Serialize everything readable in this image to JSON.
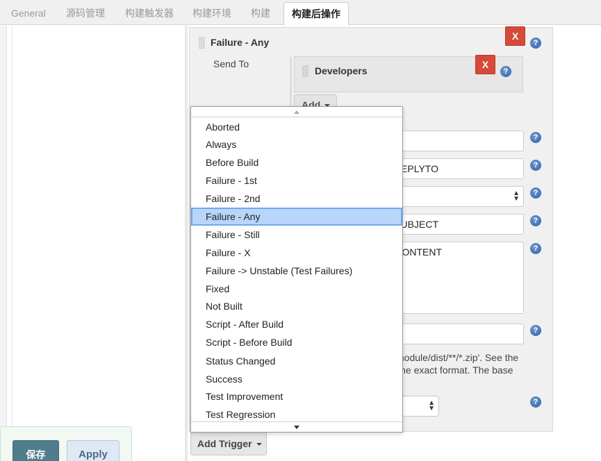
{
  "tabs": [
    {
      "label": "General"
    },
    {
      "label": "源码管理"
    },
    {
      "label": "构建触发器"
    },
    {
      "label": "构建环境"
    },
    {
      "label": "构建"
    },
    {
      "label": "构建后操作"
    }
  ],
  "trigger": {
    "title": "Failure - Any",
    "send_to_label": "Send To",
    "remove_label": "X",
    "help_label": "?"
  },
  "recipient": {
    "title": "Developers",
    "remove_label": "X",
    "add_label": "Add"
  },
  "fields": {
    "recipient_list": "",
    "reply_to": "$DEFAULT_REPLYTO",
    "content_type": "",
    "subject": "$DEFAULT_SUBJECT",
    "content": "$DEFAULT_CONTENT",
    "attachments": "",
    "attachments_help": [
      "module/dist/**/*.zip'. See the",
      "for the exact format. The base"
    ]
  },
  "dropdown": {
    "selected": "Failure - Any",
    "options": [
      "Aborted",
      "Always",
      "Before Build",
      "Failure - 1st",
      "Failure - 2nd",
      "Failure - Any",
      "Failure - Still",
      "Failure - X",
      "Failure -> Unstable (Test Failures)",
      "Fixed",
      "Not Built",
      "Script - After Build",
      "Script - Before Build",
      "Status Changed",
      "Success",
      "Test Improvement",
      "Test Regression"
    ]
  },
  "footer": {
    "add_trigger_label": "Add Trigger",
    "save_label": "保存",
    "apply_label": "Apply"
  },
  "colors": {
    "danger": "#d64a39",
    "selection": "#b8d6fb",
    "save_button": "#4f7d8b"
  },
  "icons": [
    "drag-handle-icon",
    "help-icon",
    "caret-down-icon",
    "scroll-up-arrow-icon",
    "scroll-down-arrow-icon",
    "select-arrows-icon"
  ]
}
